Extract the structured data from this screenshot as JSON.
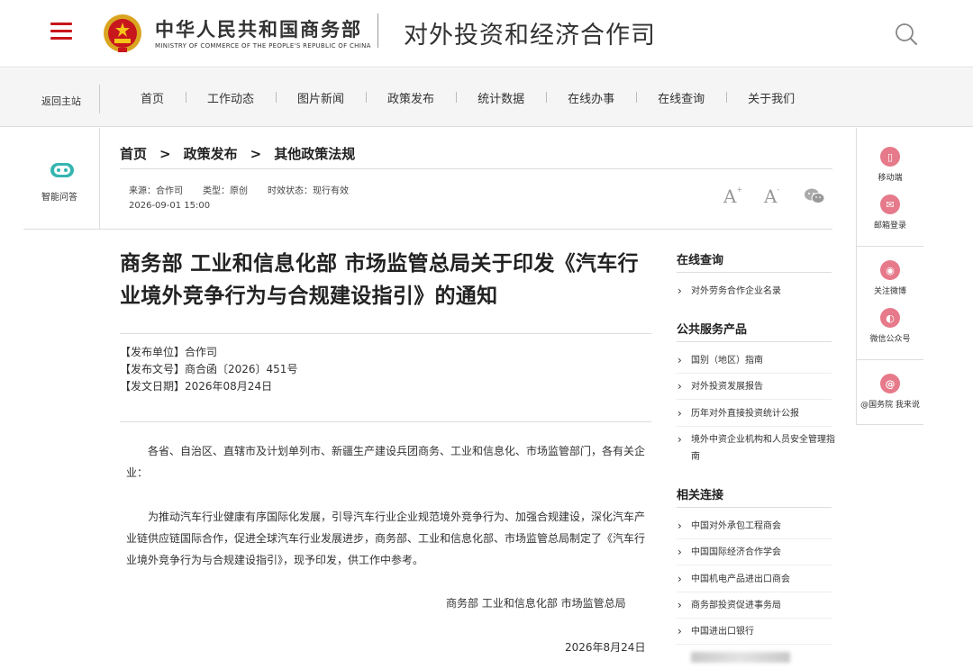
{
  "header": {
    "ministry_cn": "中华人民共和国商务部",
    "ministry_en": "MINISTRY OF COMMERCE OF THE PEOPLE'S REPUBLIC OF CHINA",
    "department": "对外投资和经济合作司"
  },
  "nav": {
    "back_label": "返回主站",
    "items": [
      "首页",
      "工作动态",
      "图片新闻",
      "政策发布",
      "统计数据",
      "在线办事",
      "在线查询",
      "关于我们"
    ]
  },
  "left_sidebar": {
    "label": "智能问答"
  },
  "breadcrumb": [
    "首页",
    "政策发布",
    "其他政策法规"
  ],
  "breadcrumb_sep": ">",
  "meta": {
    "source": "来源：合作司",
    "type": "类型：原创",
    "status": "时效状态：现行有效",
    "datetime": "2026-09-01 15:00"
  },
  "font_controls": {
    "larger": "A",
    "smaller": "A",
    "larger_sup": "+",
    "smaller_sup": "-"
  },
  "article": {
    "title": "商务部 工业和信息化部 市场监管总局关于印发《汽车行业境外竞争行为与合规建设指引》的通知",
    "issuer": "【发布单位】合作司",
    "doc_number": "【发布文号】商合函〔2026〕451号",
    "issue_date": "【发文日期】2026年08月24日",
    "para1": "各省、自治区、直辖市及计划单列市、新疆生产建设兵团商务、工业和信息化、市场监管部门，各有关企业：",
    "para2": "为推动汽车行业健康有序国际化发展，引导汽车行业企业规范境外竞争行为、加强合规建设，深化汽车产业链供应链国际合作，促进全球汽车行业发展进步，商务部、工业和信息化部、市场监管总局制定了《汽车行业境外竞争行为与合规建设指引》，现予印发，供工作中参考。",
    "signature": "商务部  工业和信息化部  市场监管总局",
    "sign_date": "2026年8月24日"
  },
  "right_column": {
    "online_query": {
      "title": "在线查询",
      "links": [
        "对外劳务合作企业名录"
      ]
    },
    "public_services": {
      "title": "公共服务产品",
      "links": [
        "国别（地区）指南",
        "对外投资发展报告",
        "历年对外直接投资统计公报",
        "境外中资企业机构和人员安全管理指南"
      ]
    },
    "related_links": {
      "title": "相关连接",
      "links": [
        "中国对外承包工程商会",
        "中国国际经济合作学会",
        "中国机电产品进出口商会",
        "商务部投资促进事务局",
        "中国进出口银行"
      ]
    }
  },
  "right_sidebar": {
    "items": [
      {
        "label": "移动端",
        "icon": "mobile-icon"
      },
      {
        "label": "邮箱登录",
        "icon": "mail-icon"
      },
      {
        "label": "关注微博",
        "icon": "weibo-icon"
      },
      {
        "label": "微信公众号",
        "icon": "wechat-icon"
      },
      {
        "label": "@国务院 我来说",
        "icon": "at-icon"
      }
    ]
  },
  "colors": {
    "brand_red": "#c8161d",
    "sidebar_pink": "#e67a8a",
    "robot_teal": "#36b5b0"
  }
}
